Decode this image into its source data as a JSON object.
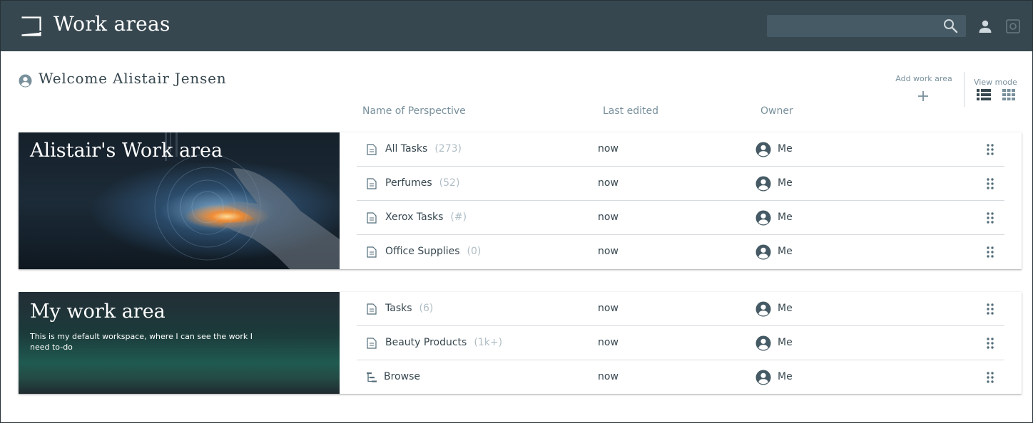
{
  "header": {
    "title": "Work areas",
    "search_placeholder": "",
    "icons": [
      "app-logo-icon",
      "search-icon",
      "user-icon",
      "gear-icon"
    ]
  },
  "welcome": {
    "text": "Welcome Alistair Jensen"
  },
  "toolbar": {
    "add_work_area_label": "Add work area",
    "view_mode_label": "View mode"
  },
  "columns": {
    "name": "Name of Perspective",
    "edited": "Last edited",
    "owner": "Owner"
  },
  "work_areas": [
    {
      "title": "Alistair's Work area",
      "description": "",
      "perspectives": [
        {
          "name": "All Tasks",
          "count": "(273)",
          "edited": "now",
          "owner": "Me",
          "icon": "document-icon"
        },
        {
          "name": "Perfumes",
          "count": "(52)",
          "edited": "now",
          "owner": "Me",
          "icon": "document-icon"
        },
        {
          "name": "Xerox Tasks",
          "count": "(#)",
          "edited": "now",
          "owner": "Me",
          "icon": "document-icon"
        },
        {
          "name": "Office Supplies",
          "count": "(0)",
          "edited": "now",
          "owner": "Me",
          "icon": "document-icon"
        }
      ]
    },
    {
      "title": "My work area",
      "description": "This is my default workspace, where I can see the work I need to-do",
      "perspectives": [
        {
          "name": "Tasks",
          "count": "(6)",
          "edited": "now",
          "owner": "Me",
          "icon": "document-icon"
        },
        {
          "name": "Beauty Products",
          "count": "(1k+)",
          "edited": "now",
          "owner": "Me",
          "icon": "document-icon"
        },
        {
          "name": "Browse",
          "count": "",
          "edited": "now",
          "owner": "Me",
          "icon": "hierarchy-icon"
        }
      ]
    }
  ],
  "colors": {
    "header_bg": "#37474f",
    "text": "#37474f",
    "muted": "#b0bec5"
  }
}
